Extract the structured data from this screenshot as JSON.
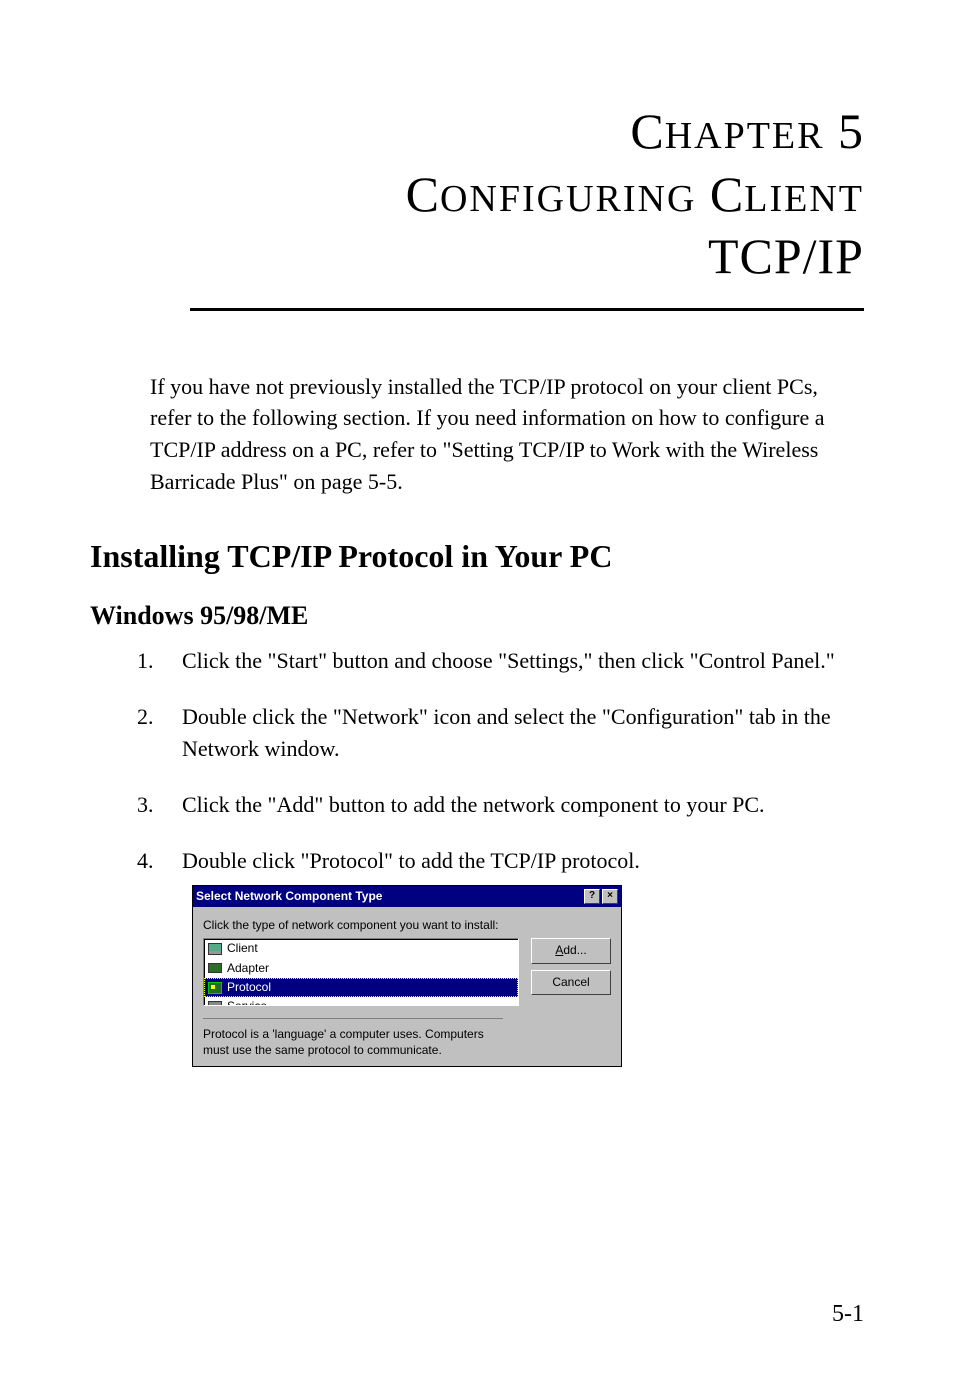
{
  "chapter": {
    "label_word_1_cap": "C",
    "label_word_1_rest": "HAPTER",
    "number": "5",
    "title_word_1_cap": "C",
    "title_word_1_rest": "ONFIGURING",
    "title_word_2_cap": "C",
    "title_word_2_rest": "LIENT",
    "title_word_3": "TCP/IP"
  },
  "intro_paragraph": "If you have not previously installed the TCP/IP protocol on your client PCs, refer to the following section. If you need information on how to configure a TCP/IP address on a PC, refer to \"Setting TCP/IP to Work with the Wireless Barricade Plus\" on page 5-5.",
  "section_heading": "Installing TCP/IP Protocol in Your PC",
  "subsection_heading": "Windows 95/98/ME",
  "steps": [
    "Click the \"Start\" button and choose \"Settings,\" then click \"Control Panel.\"",
    "Double click the \"Network\" icon and select the \"Configuration\" tab in the Network window.",
    "Click the \"Add\" button to add the network component to your PC.",
    "Double click \"Protocol\" to add the TCP/IP protocol."
  ],
  "dialog": {
    "title": "Select Network Component Type",
    "help_glyph": "?",
    "close_glyph": "×",
    "prompt": "Click the type of network component you want to install:",
    "items": [
      {
        "label": "Client",
        "selected": false,
        "icon": "monitor"
      },
      {
        "label": "Adapter",
        "selected": false,
        "icon": "adapter"
      },
      {
        "label": "Protocol",
        "selected": true,
        "icon": "protocol"
      },
      {
        "label": "Service",
        "selected": false,
        "icon": "service"
      }
    ],
    "add_button_prefix": "A",
    "add_button_rest": "dd...",
    "cancel_button": "Cancel",
    "footer": "Protocol is a 'language' a computer uses. Computers must use the same protocol to communicate."
  },
  "page_number": "5-1"
}
